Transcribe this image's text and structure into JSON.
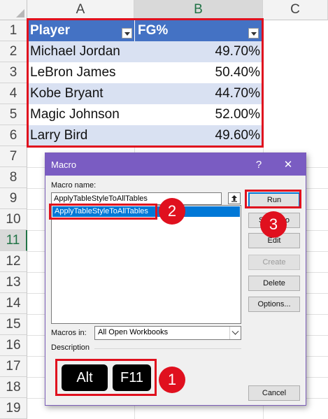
{
  "spreadsheet": {
    "columns": [
      "A",
      "B",
      "C"
    ],
    "selected_column": "B",
    "rows": [
      "1",
      "2",
      "3",
      "4",
      "5",
      "6",
      "7",
      "8",
      "9",
      "10",
      "11",
      "12",
      "13",
      "14",
      "15",
      "16",
      "17",
      "18",
      "19"
    ],
    "selected_row": "11",
    "table": {
      "headers": [
        "Player",
        "FG%"
      ],
      "rows": [
        [
          "Michael Jordan",
          "49.70%"
        ],
        [
          "LeBron James",
          "50.40%"
        ],
        [
          "Kobe Bryant",
          "44.70%"
        ],
        [
          "Magic Johnson",
          "52.00%"
        ],
        [
          "Larry Bird",
          "49.60%"
        ]
      ]
    },
    "colors": {
      "header": "#4472c4",
      "band": "#d9e1f2",
      "highlight": "#e0101e"
    }
  },
  "dialog": {
    "title": "Macro",
    "help_label": "?",
    "close_label": "✕",
    "macro_name_label": "Macro name:",
    "macro_name_value": "ApplyTableStyleToAllTables",
    "macro_list": [
      "ApplyTableStyleToAllTables"
    ],
    "buttons": {
      "run": "Run",
      "step_into": "Step Into",
      "edit": "Edit",
      "create": "Create",
      "delete": "Delete",
      "options": "Options...",
      "cancel": "Cancel"
    },
    "macros_in_label": "Macros in:",
    "macros_in_value": "All Open Workbooks",
    "description_label": "Description",
    "accent_color": "#7a5cc2"
  },
  "annotations": {
    "keys": [
      "Alt",
      "F11"
    ],
    "badges": [
      "1",
      "2",
      "3"
    ]
  }
}
